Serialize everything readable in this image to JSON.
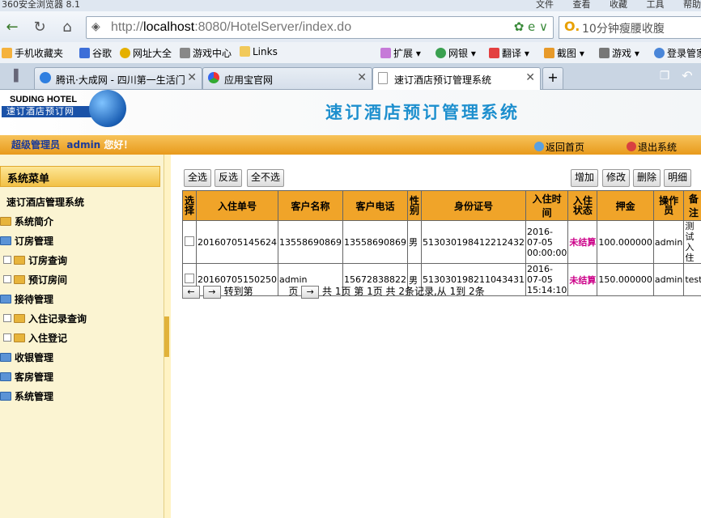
{
  "browser": {
    "title": "360安全浏览器 8.1",
    "menus": [
      "文件",
      "查看",
      "收藏",
      "工具",
      "帮助"
    ],
    "url_prefix": "http://",
    "url_host": "localhost",
    "url_rest": ":8080/HotelServer/index.do",
    "search_text": "10分钟瘦腰收腹",
    "favorites": [
      "手机收藏夹",
      "谷歌",
      "网址大全",
      "游戏中心",
      "Links"
    ],
    "toolbar_right": [
      "扩展",
      "网银",
      "翻译",
      "截图",
      "游戏",
      "登录管家"
    ],
    "tabs": [
      "腾讯·大成网 - 四川第一生活门",
      "应用宝官网",
      "速订酒店预订管理系统"
    ]
  },
  "header": {
    "logo_en": "SUDING HOTEL",
    "logo_cn": "速订酒店预订网",
    "system_title": "速订酒店预订管理系统"
  },
  "userbar": {
    "role": "超级管理员",
    "user": "admin",
    "greeting": "您好！",
    "home_link": "返回首页",
    "logout_link": "退出系统"
  },
  "sidebar": {
    "menu_title": "系统菜单",
    "root": "速订酒店管理系统",
    "items": [
      {
        "label": "系统简介"
      },
      {
        "label": "订房管理"
      },
      {
        "label": "订房查询"
      },
      {
        "label": "预订房间"
      },
      {
        "label": "接待管理"
      },
      {
        "label": "入住记录查询"
      },
      {
        "label": "入住登记"
      },
      {
        "label": "收银管理"
      },
      {
        "label": "客房管理"
      },
      {
        "label": "系统管理"
      }
    ]
  },
  "actions": {
    "select_all": "全选",
    "invert": "反选",
    "select_none": "全不选",
    "add": "增加",
    "edit": "修改",
    "delete": "删除",
    "detail": "明细"
  },
  "table": {
    "headers": [
      "选择",
      "入住单号",
      "客户名称",
      "客户电话",
      "性别",
      "身份证号",
      "入住时间",
      "入住状态",
      "押金",
      "操作员",
      "备注"
    ],
    "rows": [
      [
        "",
        "20160705145624",
        "13558690869",
        "13558690869",
        "男",
        "513030198412212432",
        "2016-07-05 00:00:00",
        "未结算",
        "100.000000",
        "admin",
        "测试入住"
      ],
      [
        "",
        "20160705150250",
        "admin",
        "15672838822",
        "男",
        "513030198211043431",
        "2016-07-05 15:14:10",
        "未结算",
        "150.000000",
        "admin",
        "test"
      ]
    ]
  },
  "pager": {
    "goto_label": "转到第",
    "page_label": "页",
    "summary": "共 1页 第 1页 共 2条记录,从 1到 2条"
  }
}
